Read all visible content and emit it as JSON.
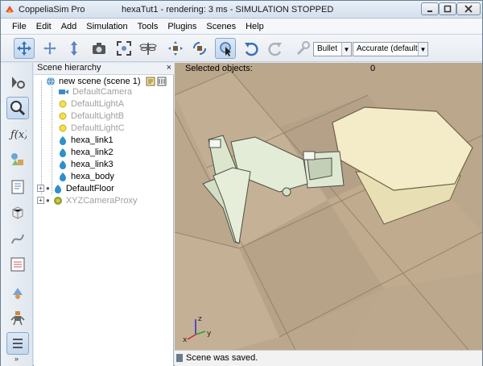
{
  "window": {
    "app_name": "CoppeliaSim Pro",
    "doc_title": "hexaTut1 - rendering: 3 ms - SIMULATION STOPPED"
  },
  "menu": [
    "File",
    "Edit",
    "Add",
    "Simulation",
    "Tools",
    "Plugins",
    "Scenes",
    "Help"
  ],
  "toolbar": {
    "engine": "Bullet",
    "accuracy": "Accurate (default)"
  },
  "hierarchy": {
    "title": "Scene hierarchy",
    "close": "×",
    "items": [
      {
        "label": "new scene (scene 1)",
        "icon": "globe-icon",
        "greyed": false
      },
      {
        "label": "DefaultCamera",
        "icon": "camera-icon",
        "greyed": true
      },
      {
        "label": "DefaultLightA",
        "icon": "light-icon",
        "greyed": true
      },
      {
        "label": "DefaultLightB",
        "icon": "light-icon",
        "greyed": true
      },
      {
        "label": "DefaultLightC",
        "icon": "light-icon",
        "greyed": true
      },
      {
        "label": "hexa_link1",
        "icon": "shape-icon",
        "greyed": false
      },
      {
        "label": "hexa_link2",
        "icon": "shape-icon",
        "greyed": false
      },
      {
        "label": "hexa_link3",
        "icon": "shape-icon",
        "greyed": false
      },
      {
        "label": "hexa_body",
        "icon": "shape-icon",
        "greyed": false
      },
      {
        "label": "DefaultFloor",
        "icon": "shape-icon",
        "greyed": false
      },
      {
        "label": "XYZCameraProxy",
        "icon": "camera-proxy-icon",
        "greyed": true
      }
    ]
  },
  "viewport": {
    "selected_label": "Selected objects:",
    "selected_count": "0",
    "axis_x": "x",
    "axis_y": "y",
    "axis_z": "z"
  },
  "status": {
    "message": "Scene was saved."
  },
  "colors": {
    "title_bg": "#d4e0ee",
    "floor_tile": "#b9a68c",
    "body_plate": "#f3ecc7",
    "link_green": "#dfe9d2",
    "status_text": "#000000"
  }
}
